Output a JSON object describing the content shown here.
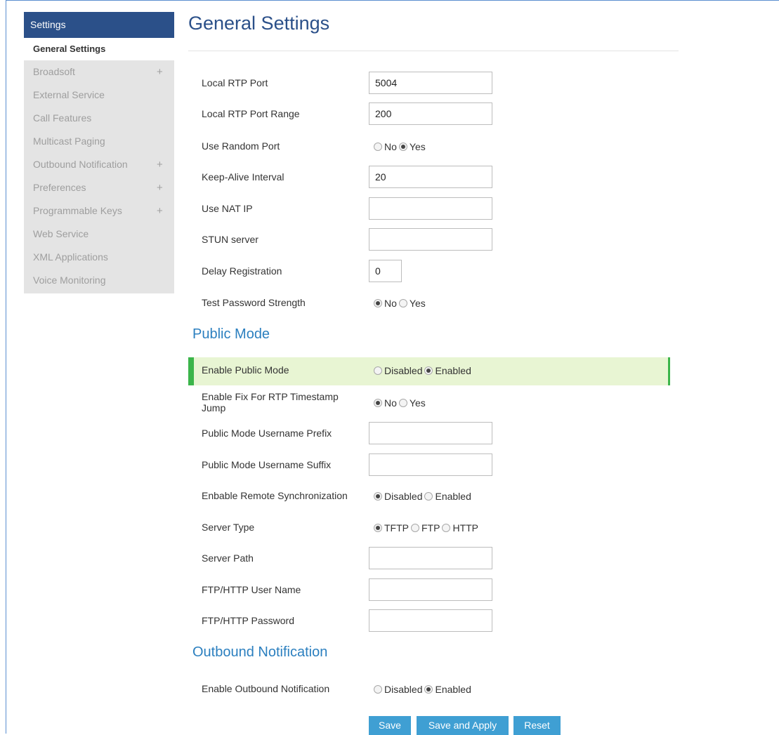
{
  "sidebar": {
    "header": "Settings",
    "active": "General Settings",
    "items": [
      {
        "label": "Broadsoft",
        "expandable": true
      },
      {
        "label": "External Service",
        "expandable": false
      },
      {
        "label": "Call Features",
        "expandable": false
      },
      {
        "label": "Multicast Paging",
        "expandable": false
      },
      {
        "label": "Outbound Notification",
        "expandable": true
      },
      {
        "label": "Preferences",
        "expandable": true
      },
      {
        "label": "Programmable Keys",
        "expandable": true
      },
      {
        "label": "Web Service",
        "expandable": false
      },
      {
        "label": "XML Applications",
        "expandable": false
      },
      {
        "label": "Voice Monitoring",
        "expandable": false
      }
    ]
  },
  "page": {
    "title": "General Settings"
  },
  "general": {
    "local_rtp_port": {
      "label": "Local RTP Port",
      "value": "5004"
    },
    "local_rtp_port_range": {
      "label": "Local RTP Port Range",
      "value": "200"
    },
    "use_random_port": {
      "label": "Use Random Port",
      "options": [
        "No",
        "Yes"
      ],
      "selected": "Yes"
    },
    "keep_alive_interval": {
      "label": "Keep-Alive Interval",
      "value": "20"
    },
    "use_nat_ip": {
      "label": "Use NAT IP",
      "value": ""
    },
    "stun_server": {
      "label": "STUN server",
      "value": ""
    },
    "delay_registration": {
      "label": "Delay Registration",
      "value": "0"
    },
    "test_password_strength": {
      "label": "Test Password Strength",
      "options": [
        "No",
        "Yes"
      ],
      "selected": "No"
    }
  },
  "public_mode": {
    "title": "Public Mode",
    "enable_public_mode": {
      "label": "Enable Public Mode",
      "options": [
        "Disabled",
        "Enabled"
      ],
      "selected": "Enabled"
    },
    "rtp_timestamp_jump": {
      "label": "Enable Fix For RTP Timestamp Jump",
      "options": [
        "No",
        "Yes"
      ],
      "selected": "No"
    },
    "username_prefix": {
      "label": "Public Mode Username Prefix",
      "value": ""
    },
    "username_suffix": {
      "label": "Public Mode Username Suffix",
      "value": ""
    },
    "remote_sync": {
      "label": "Enbable Remote Synchronization",
      "options": [
        "Disabled",
        "Enabled"
      ],
      "selected": "Disabled"
    },
    "server_type": {
      "label": "Server Type",
      "options": [
        "TFTP",
        "FTP",
        "HTTP"
      ],
      "selected": "TFTP"
    },
    "server_path": {
      "label": "Server Path",
      "value": ""
    },
    "ftp_user": {
      "label": "FTP/HTTP User Name",
      "value": ""
    },
    "ftp_password": {
      "label": "FTP/HTTP Password",
      "value": ""
    }
  },
  "outbound": {
    "title": "Outbound Notification",
    "enable": {
      "label": "Enable Outbound Notification",
      "options": [
        "Disabled",
        "Enabled"
      ],
      "selected": "Enabled"
    }
  },
  "buttons": {
    "save": "Save",
    "save_apply": "Save and Apply",
    "reset": "Reset"
  },
  "colors": {
    "accent": "#3f9fd3",
    "header": "#2b5089",
    "highlight": "#e8f5d3",
    "highlight_border": "#3bb54a"
  }
}
